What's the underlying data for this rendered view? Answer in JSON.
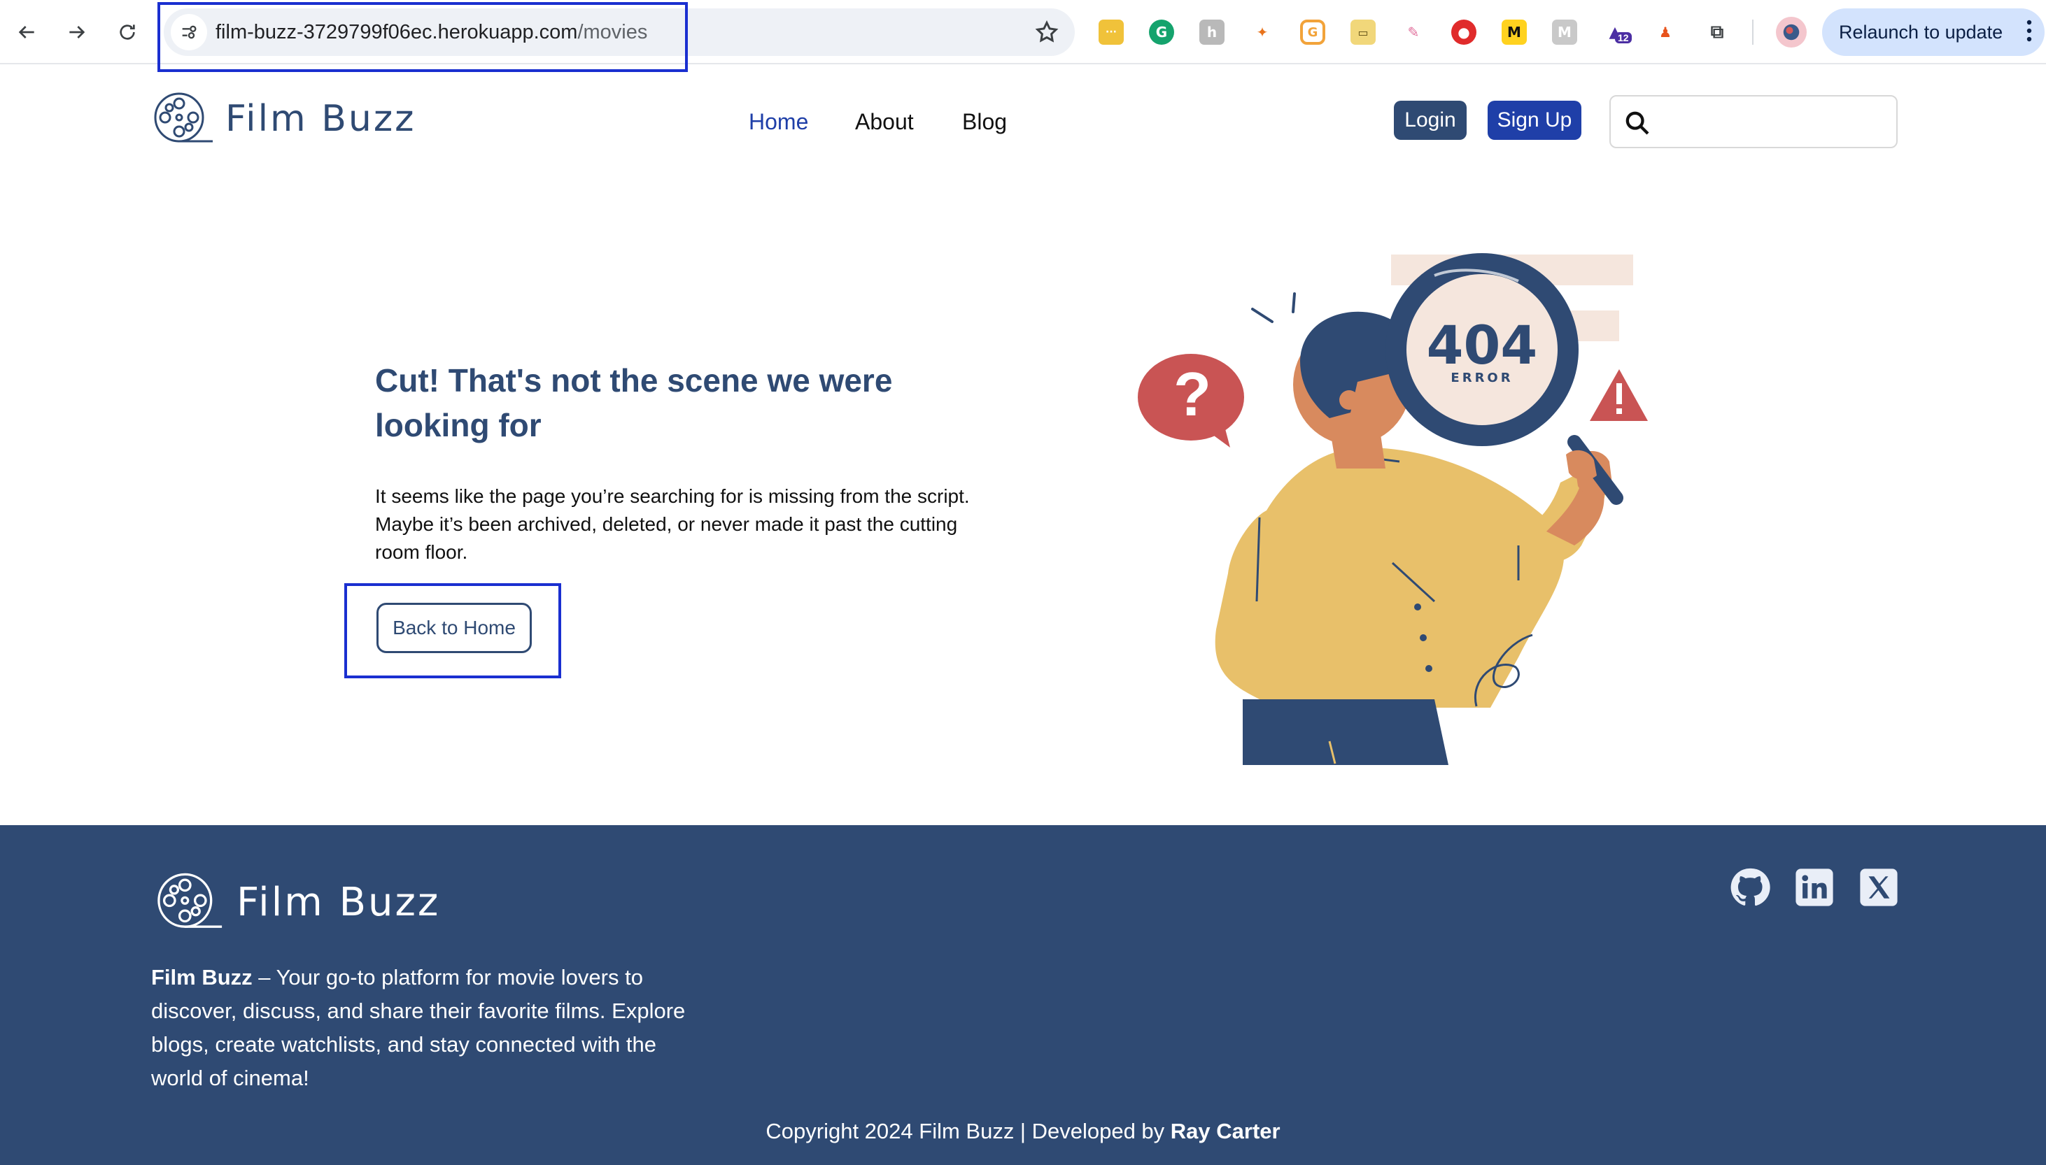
{
  "browser": {
    "url_host": "film-buzz-3729799f06ec.herokuapp.com",
    "url_path": "/movies",
    "relaunch_label": "Relaunch to update",
    "extension_badge": "12"
  },
  "header": {
    "logo_text": "Film Buzz",
    "nav": [
      {
        "label": "Home",
        "active": true
      },
      {
        "label": "About",
        "active": false
      },
      {
        "label": "Blog",
        "active": false
      }
    ],
    "login_label": "Login",
    "signup_label": "Sign Up",
    "search_placeholder": ""
  },
  "main": {
    "heading": "Cut! That's not the scene we were looking for",
    "description": "It seems like the page you’re searching for is missing from the script. Maybe it’s been archived, deleted, or never made it past the cutting room floor.",
    "back_button_label": "Back to Home",
    "illustration": {
      "code": "404",
      "caption": "ERROR"
    }
  },
  "footer": {
    "logo_text": "Film Buzz",
    "blurb_brand": "Film Buzz",
    "blurb_text": " – Your go-to platform for movie lovers to discover, discuss, and share their favorite films. Explore blogs, create watchlists, and stay connected with the world of cinema!",
    "copyright_prefix": "Copyright 2024 Film Buzz | Developed by ",
    "copyright_author": "Ray Carter",
    "socials": [
      "github-icon",
      "linkedin-icon",
      "x-icon"
    ]
  },
  "colors": {
    "brand_navy": "#2f4a73",
    "nav_active": "#1f3fa8",
    "signup_bg": "#1f3fa8",
    "annotation_blue": "#1a2fd0"
  }
}
